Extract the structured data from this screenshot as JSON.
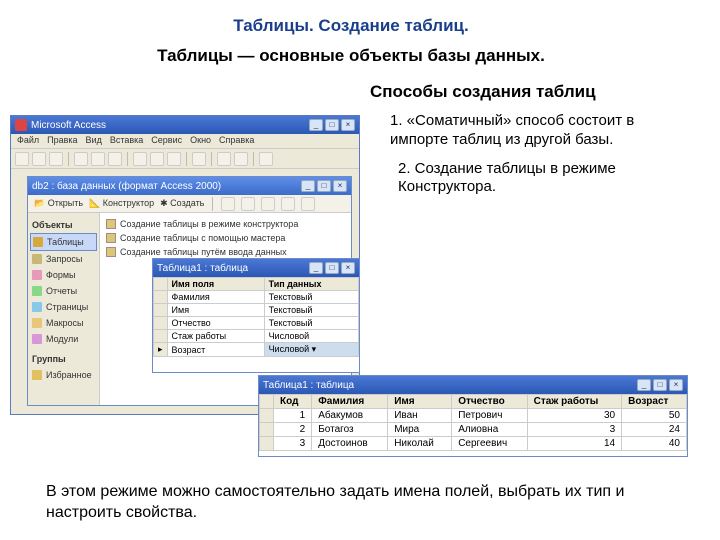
{
  "title": "Таблицы. Создание таблиц.",
  "subtitle": "Таблицы — основные объекты базы данных.",
  "heading": "Способы создания таблиц",
  "bullet1": "1. «Соматичный» способ состоит в импорте таблиц из другой базы.",
  "bullet2": "2. Создание таблицы в режиме Конструктора.",
  "footer": "В этом режиме можно самостоятельно задать имена полей, выбрать их тип и настроить свойства.",
  "access": {
    "app_title": "Microsoft Access",
    "menu": [
      "Файл",
      "Правка",
      "Вид",
      "Вставка",
      "Сервис",
      "Окно",
      "Справка"
    ],
    "db_title": "db2 : база данных (формат Access 2000)",
    "db_buttons": [
      "Открыть",
      "Конструктор",
      "Создать"
    ],
    "nav": {
      "header": "Объекты",
      "items": [
        "Таблицы",
        "Запросы",
        "Формы",
        "Отчеты",
        "Страницы",
        "Макросы",
        "Модули"
      ],
      "groups": "Группы",
      "fav": "Избранное"
    },
    "nav_colors": [
      "#d8a838",
      "#c8b878",
      "#e898b8",
      "#88d888",
      "#88c8e8",
      "#e8c878",
      "#d898d8"
    ],
    "list": [
      "Создание таблицы в режиме конструктора",
      "Создание таблицы с помощью мастера",
      "Создание таблицы путём ввода данных"
    ]
  },
  "design": {
    "title": "Таблица1 : таблица",
    "cols": [
      "Имя поля",
      "Тип данных"
    ],
    "rows": [
      [
        "Фамилия",
        "Текстовый"
      ],
      [
        "Имя",
        "Текстовый"
      ],
      [
        "Отчество",
        "Текстовый"
      ],
      [
        "Стаж работы",
        "Числовой"
      ],
      [
        "Возраст",
        "Числовой"
      ]
    ],
    "sel_label": "▸"
  },
  "sheet": {
    "title": "Таблица1 : таблица",
    "cols": [
      "Код",
      "Фамилия",
      "Имя",
      "Отчество",
      "Стаж работы",
      "Возраст"
    ],
    "rows": [
      [
        "1",
        "Абакумов",
        "Иван",
        "Петрович",
        "30",
        "50"
      ],
      [
        "2",
        "Ботагоз",
        "Мира",
        "Алиовна",
        "3",
        "24"
      ],
      [
        "3",
        "Достоинов",
        "Николай",
        "Сергеевич",
        "14",
        "40"
      ]
    ]
  }
}
